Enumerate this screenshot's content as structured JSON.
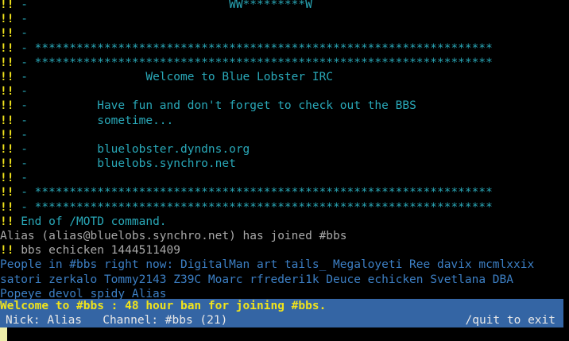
{
  "colors": {
    "background": "#000000",
    "prefix": "#f0e31c",
    "motd": "#29a8b8",
    "status_bg": "#3465a4",
    "title_text": "#f0e31c",
    "status_text": "#e8e8e8",
    "names": "#3c7fc4"
  },
  "terminal": {
    "prefix": "!!",
    "motd_lines": [
      " -                             WW*********W",
      " -",
      " -",
      " - ******************************************************************",
      " - ******************************************************************",
      " -                 Welcome to Blue Lobster IRC",
      " -",
      " -          Have fun and don't forget to check out the BBS",
      " -          sometime...",
      " -",
      " -          bluelobster.dyndns.org",
      " -          bluelobs.synchro.net",
      " -",
      " - ******************************************************************",
      " - ******************************************************************"
    ],
    "end_motd": " End of /MOTD command.",
    "join_message": "Alias (alias@bluelobs.synchro.net) has joined #bbs",
    "info_message": " bbs echicken 1444511409",
    "names_lines": [
      "People in #bbs right now: DigitalMan art tails_ Megaloyeti Ree davix mcmlxxix",
      "satori zerkalo Tommy2143 Z39C Moarc rfrederi1k Deuce echicken Svetlana DBA",
      "Popeye devol spidy Alias"
    ]
  },
  "title_bar": {
    "topic": "Welcome to #bbs : 48 hour ban for joining #bbs."
  },
  "status_bar": {
    "left": "Nick: Alias   Channel: #bbs (21)",
    "right": "/quit to exit"
  },
  "input": {
    "value": ""
  }
}
